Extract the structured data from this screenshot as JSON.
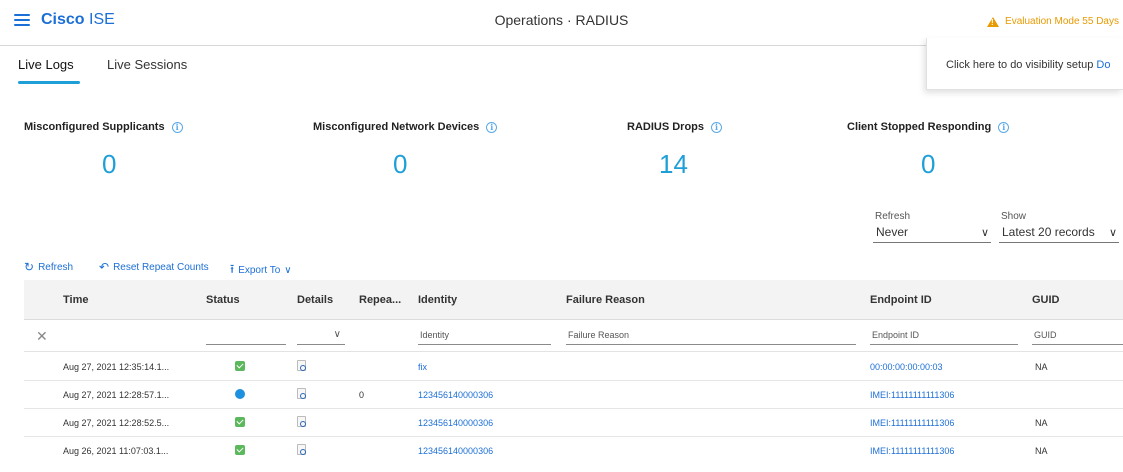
{
  "app": {
    "brand_bold": "Cisco",
    "brand_light": "ISE",
    "page_title": "Operations · RADIUS",
    "eval_notice": "Evaluation Mode 55 Days"
  },
  "tabs": [
    {
      "label": "Live Logs",
      "active": true
    },
    {
      "label": "Live Sessions",
      "active": false
    }
  ],
  "popover": {
    "text": "Click here to do visibility setup ",
    "link": "Do"
  },
  "metrics": [
    {
      "label": "Misconfigured Supplicants",
      "value": "0",
      "color": "#1e9fd8"
    },
    {
      "label": "Misconfigured Network Devices",
      "value": "0",
      "color": "#1e9fd8"
    },
    {
      "label": "RADIUS Drops",
      "value": "14",
      "color": "#1e9fd8"
    },
    {
      "label": "Client Stopped Responding",
      "value": "0",
      "color": "#1e9fd8"
    }
  ],
  "controls": {
    "refresh_label": "Refresh",
    "refresh_value": "Never",
    "show_label": "Show",
    "show_value": "Latest 20 records"
  },
  "toolbar": {
    "refresh": "Refresh",
    "reset": "Reset Repeat Counts",
    "export": "Export To"
  },
  "table": {
    "columns": [
      "Time",
      "Status",
      "Details",
      "Repea...",
      "Identity",
      "Failure Reason",
      "Endpoint ID",
      "GUID"
    ],
    "filters": {
      "identity": "Identity",
      "failure_reason": "Failure Reason",
      "endpoint_id": "Endpoint ID",
      "guid": "GUID"
    },
    "rows": [
      {
        "time": "Aug 27, 2021 12:35:14.1...",
        "status": "success",
        "repeat": "",
        "identity": "fix",
        "endpoint": "00:00:00:00:00:03",
        "guid": "NA"
      },
      {
        "time": "Aug 27, 2021 12:28:57.1...",
        "status": "session",
        "repeat": "0",
        "identity": "123456140000306",
        "endpoint": "IMEI:11111111111306",
        "guid": ""
      },
      {
        "time": "Aug 27, 2021 12:28:52.5...",
        "status": "success",
        "repeat": "",
        "identity": "123456140000306",
        "endpoint": "IMEI:11111111111306",
        "guid": "NA"
      },
      {
        "time": "Aug 26, 2021 11:07:03.1...",
        "status": "success",
        "repeat": "",
        "identity": "123456140000306",
        "endpoint": "IMEI:11111111111306",
        "guid": "NA"
      }
    ]
  }
}
